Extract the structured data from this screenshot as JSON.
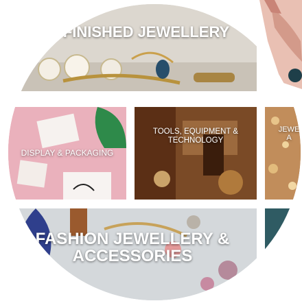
{
  "categories": {
    "finished": {
      "label": "FINISHED JEWELLERY"
    },
    "display": {
      "label": "DISPLAY & PACKAGING"
    },
    "tools": {
      "label": "TOOLS, EQUIPMENT & TECHNOLOGY"
    },
    "partial_right": {
      "label": "JEWE A"
    },
    "fashion": {
      "label": "FASHION JEWELLERY & ACCESSORIES"
    }
  },
  "colors": {
    "finished_bg": "#d6d1c9",
    "display_bg": "#e7a9b4",
    "tools_bg": "#6b3b1c",
    "fashion_bg": "#cfd3d6",
    "accent_teal": "#2f5b63"
  }
}
